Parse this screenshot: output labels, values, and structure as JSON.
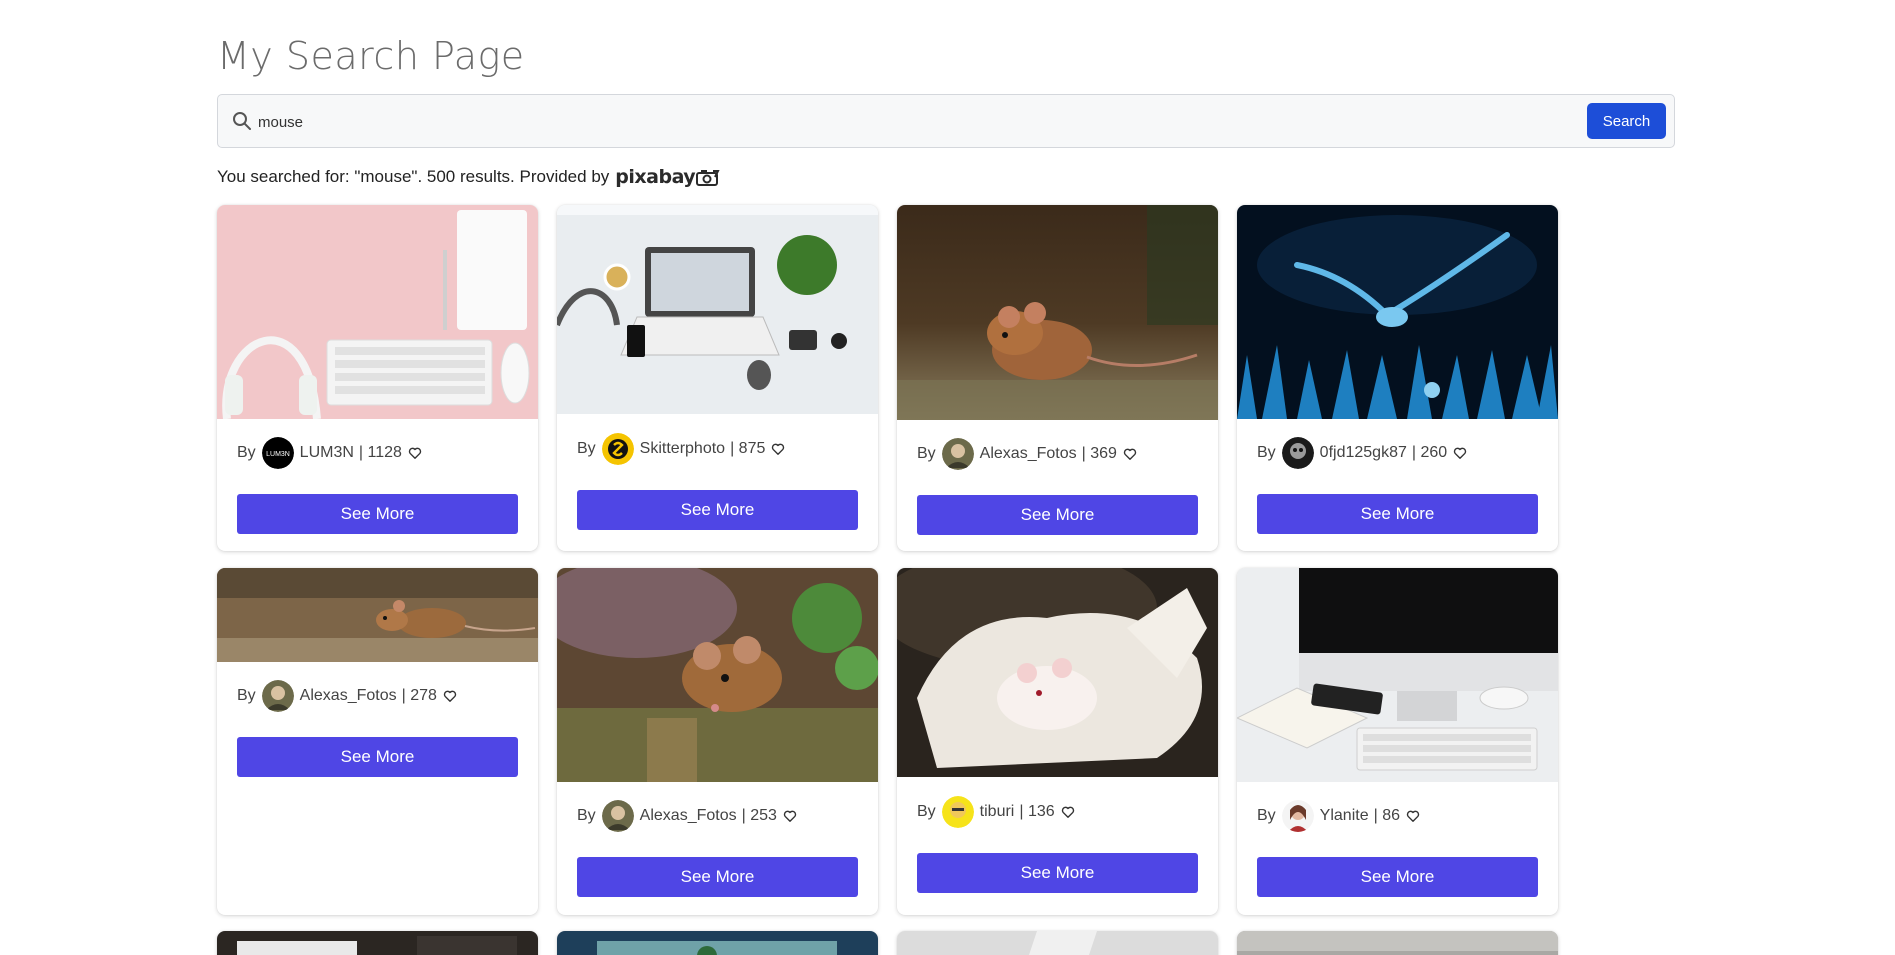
{
  "page": {
    "title": "My Search Page"
  },
  "search": {
    "value": "mouse",
    "button_label": "Search"
  },
  "results": {
    "prefix": "You searched for: \"mouse\". 500 results. Provided by",
    "provider": "pixabay"
  },
  "cards": [
    {
      "by_label": "By",
      "author": "LUM3N",
      "avatar_text": "LUM3N",
      "likes": "| 1128",
      "button_label": "See More",
      "image": "desk with headphones, keyboard, notebook",
      "accent": "#f2c7c9"
    },
    {
      "by_label": "By",
      "author": "Skitterphoto",
      "likes": "| 875",
      "button_label": "See More",
      "image": "laptop, headphones, camera, plant on white desk",
      "accent": "#e9edf0"
    },
    {
      "by_label": "By",
      "author": "Alexas_Fotos",
      "likes": "| 369",
      "button_label": "See More",
      "image": "brown mouse on ground",
      "accent": "#6b4a2a"
    },
    {
      "by_label": "By",
      "author": "0fjd125gk87",
      "likes": "| 260",
      "button_label": "See More",
      "image": "owl flying over blue grass at night",
      "accent": "#0a2340"
    },
    {
      "by_label": "By",
      "author": "Alexas_Fotos",
      "likes": "| 278",
      "button_label": "See More",
      "image": "mouse walking on ground",
      "accent": "#8a6a48"
    },
    {
      "by_label": "By",
      "author": "Alexas_Fotos",
      "likes": "| 253",
      "button_label": "See More",
      "image": "mouse on mossy wood",
      "accent": "#7a5a38"
    },
    {
      "by_label": "By",
      "author": "tiburi",
      "likes": "| 136",
      "button_label": "See More",
      "image": "white mouse in gloved hand",
      "accent": "#d9d6d0"
    },
    {
      "by_label": "By",
      "author": "Ylanite",
      "likes": "| 86",
      "button_label": "See More",
      "image": "imac, keyboard, mouse, book on desk",
      "accent": "#f0f0f0"
    }
  ],
  "colors": {
    "primary_button": "#4f46e5",
    "search_button": "#1d4ed8",
    "title": "#6b6b6b"
  }
}
